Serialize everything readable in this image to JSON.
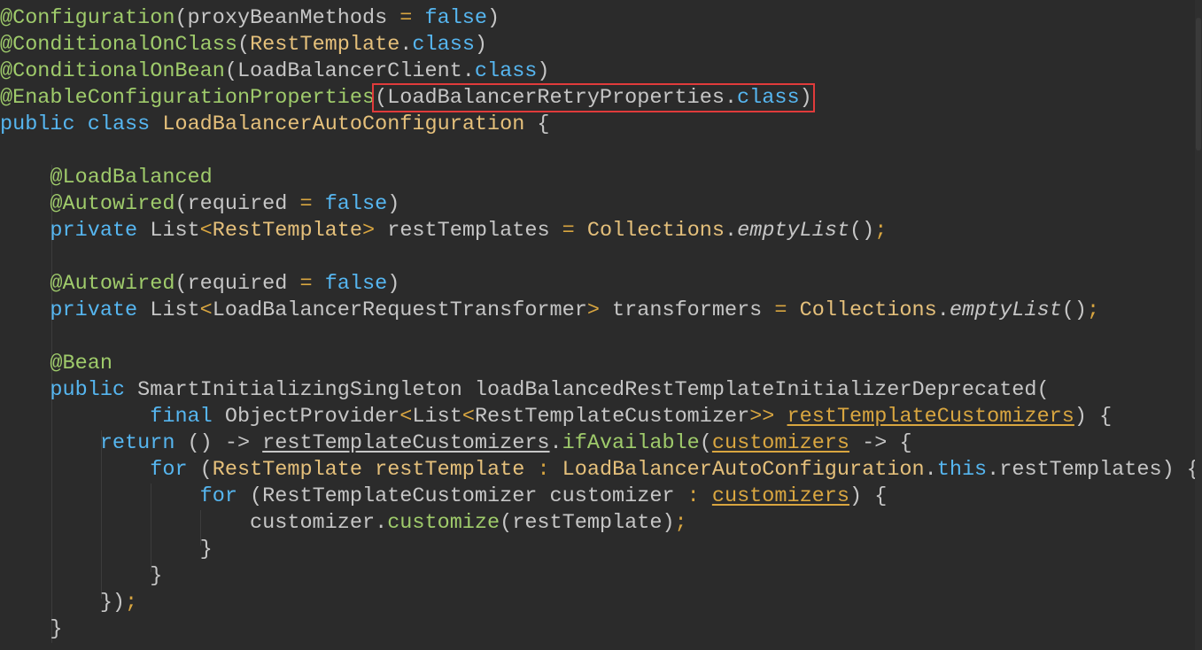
{
  "editor": {
    "language": "java",
    "highlighted_line": 4,
    "highlight_color": "#e03b3b",
    "lines": [
      [
        {
          "t": "@Configuration",
          "c": "ann"
        },
        {
          "t": "(proxyBeanMethods ",
          "c": "plain"
        },
        {
          "t": "=",
          "c": "pun"
        },
        {
          "t": " ",
          "c": "plain"
        },
        {
          "t": "false",
          "c": "kw"
        },
        {
          "t": ")",
          "c": "plain"
        }
      ],
      [
        {
          "t": "@ConditionalOnClass",
          "c": "ann"
        },
        {
          "t": "(",
          "c": "plain"
        },
        {
          "t": "RestTemplate",
          "c": "cls"
        },
        {
          "t": ".",
          "c": "plain"
        },
        {
          "t": "class",
          "c": "kw"
        },
        {
          "t": ")",
          "c": "plain"
        }
      ],
      [
        {
          "t": "@ConditionalOnBean",
          "c": "ann"
        },
        {
          "t": "(LoadBalancerClient.",
          "c": "plain"
        },
        {
          "t": "class",
          "c": "kw"
        },
        {
          "t": ")",
          "c": "plain"
        }
      ],
      [
        {
          "t": "@EnableConfigurationProperties",
          "c": "ann"
        },
        {
          "t": "(LoadBalancerRetryProperties.",
          "c": "plain",
          "box": "start"
        },
        {
          "t": "class",
          "c": "kw"
        },
        {
          "t": ")",
          "c": "plain",
          "box": "end"
        }
      ],
      [
        {
          "t": "public",
          "c": "kw"
        },
        {
          "t": " ",
          "c": "plain"
        },
        {
          "t": "class",
          "c": "kw"
        },
        {
          "t": " ",
          "c": "plain"
        },
        {
          "t": "LoadBalancerAutoConfiguration",
          "c": "cls"
        },
        {
          "t": " {",
          "c": "plain"
        }
      ],
      [],
      [
        {
          "t": "    ",
          "c": "plain"
        },
        {
          "t": "@LoadBalanced",
          "c": "ann"
        }
      ],
      [
        {
          "t": "    ",
          "c": "plain"
        },
        {
          "t": "@Autowired",
          "c": "ann"
        },
        {
          "t": "(required ",
          "c": "plain"
        },
        {
          "t": "=",
          "c": "pun"
        },
        {
          "t": " ",
          "c": "plain"
        },
        {
          "t": "false",
          "c": "kw"
        },
        {
          "t": ")",
          "c": "plain"
        }
      ],
      [
        {
          "t": "    ",
          "c": "plain"
        },
        {
          "t": "private",
          "c": "kw"
        },
        {
          "t": " List",
          "c": "plain"
        },
        {
          "t": "<",
          "c": "gen"
        },
        {
          "t": "RestTemplate",
          "c": "cls"
        },
        {
          "t": ">",
          "c": "gen"
        },
        {
          "t": " restTemplates ",
          "c": "plain"
        },
        {
          "t": "=",
          "c": "pun"
        },
        {
          "t": " ",
          "c": "plain"
        },
        {
          "t": "Collections",
          "c": "cls"
        },
        {
          "t": ".",
          "c": "plain"
        },
        {
          "t": "emptyList",
          "c": "ital"
        },
        {
          "t": "()",
          "c": "plain"
        },
        {
          "t": ";",
          "c": "pun"
        }
      ],
      [],
      [
        {
          "t": "    ",
          "c": "plain"
        },
        {
          "t": "@Autowired",
          "c": "ann"
        },
        {
          "t": "(required ",
          "c": "plain"
        },
        {
          "t": "=",
          "c": "pun"
        },
        {
          "t": " ",
          "c": "plain"
        },
        {
          "t": "false",
          "c": "kw"
        },
        {
          "t": ")",
          "c": "plain"
        }
      ],
      [
        {
          "t": "    ",
          "c": "plain"
        },
        {
          "t": "private",
          "c": "kw"
        },
        {
          "t": " List",
          "c": "plain"
        },
        {
          "t": "<",
          "c": "gen"
        },
        {
          "t": "LoadBalancerRequestTransformer",
          "c": "plain"
        },
        {
          "t": ">",
          "c": "gen"
        },
        {
          "t": " transformers ",
          "c": "plain"
        },
        {
          "t": "=",
          "c": "pun"
        },
        {
          "t": " ",
          "c": "plain"
        },
        {
          "t": "Collections",
          "c": "cls"
        },
        {
          "t": ".",
          "c": "plain"
        },
        {
          "t": "emptyList",
          "c": "ital"
        },
        {
          "t": "()",
          "c": "plain"
        },
        {
          "t": ";",
          "c": "pun"
        }
      ],
      [],
      [
        {
          "t": "    ",
          "c": "plain"
        },
        {
          "t": "@Bean",
          "c": "ann"
        }
      ],
      [
        {
          "t": "    ",
          "c": "plain"
        },
        {
          "t": "public",
          "c": "kw"
        },
        {
          "t": " SmartInitializingSingleton loadBalancedRestTemplateInitializerDeprecated(",
          "c": "plain"
        }
      ],
      [
        {
          "t": "            ",
          "c": "plain"
        },
        {
          "t": "final",
          "c": "kw"
        },
        {
          "t": " ObjectProvider",
          "c": "plain"
        },
        {
          "t": "<",
          "c": "gen"
        },
        {
          "t": "List",
          "c": "plain"
        },
        {
          "t": "<",
          "c": "gen"
        },
        {
          "t": "RestTemplateCustomizer",
          "c": "plain"
        },
        {
          "t": ">>",
          "c": "gen"
        },
        {
          "t": " ",
          "c": "plain"
        },
        {
          "t": "restTemplateCustomizers",
          "c": "ul"
        },
        {
          "t": ") {",
          "c": "plain"
        }
      ],
      [
        {
          "t": "        ",
          "c": "plain"
        },
        {
          "t": "return",
          "c": "kw"
        },
        {
          "t": " () -> ",
          "c": "plain"
        },
        {
          "t": "restTemplateCustomizers",
          "c": "ulplain"
        },
        {
          "t": ".",
          "c": "plain"
        },
        {
          "t": "ifAvailable",
          "c": "ann"
        },
        {
          "t": "(",
          "c": "plain"
        },
        {
          "t": "customizers",
          "c": "ul"
        },
        {
          "t": " -> {",
          "c": "plain"
        }
      ],
      [
        {
          "t": "            ",
          "c": "plain"
        },
        {
          "t": "for",
          "c": "kw"
        },
        {
          "t": " (",
          "c": "plain"
        },
        {
          "t": "RestTemplate restTemplate",
          "c": "cls"
        },
        {
          "t": " ",
          "c": "plain"
        },
        {
          "t": ":",
          "c": "pun"
        },
        {
          "t": " ",
          "c": "plain"
        },
        {
          "t": "LoadBalancerAutoConfiguration",
          "c": "cls"
        },
        {
          "t": ".",
          "c": "plain"
        },
        {
          "t": "this",
          "c": "kw"
        },
        {
          "t": ".restTemplates) {",
          "c": "plain"
        }
      ],
      [
        {
          "t": "                ",
          "c": "plain"
        },
        {
          "t": "for",
          "c": "kw"
        },
        {
          "t": " (RestTemplateCustomizer customizer ",
          "c": "plain"
        },
        {
          "t": ":",
          "c": "pun"
        },
        {
          "t": " ",
          "c": "plain"
        },
        {
          "t": "customizers",
          "c": "ul"
        },
        {
          "t": ") {",
          "c": "plain"
        }
      ],
      [
        {
          "t": "                    ",
          "c": "plain"
        },
        {
          "t": "customizer.",
          "c": "plain"
        },
        {
          "t": "customize",
          "c": "ann"
        },
        {
          "t": "(restTemplate)",
          "c": "plain"
        },
        {
          "t": ";",
          "c": "pun"
        }
      ],
      [
        {
          "t": "                ",
          "c": "plain"
        },
        {
          "t": "}",
          "c": "plain"
        }
      ],
      [
        {
          "t": "            ",
          "c": "plain"
        },
        {
          "t": "}",
          "c": "plain"
        }
      ],
      [
        {
          "t": "        ",
          "c": "plain"
        },
        {
          "t": "})",
          "c": "plain"
        },
        {
          "t": ";",
          "c": "pun"
        }
      ],
      [
        {
          "t": "    ",
          "c": "plain"
        },
        {
          "t": "}",
          "c": "plain"
        }
      ]
    ]
  }
}
